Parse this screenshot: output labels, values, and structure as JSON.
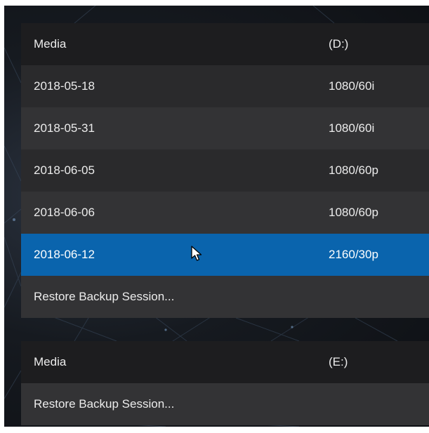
{
  "drive_d": {
    "header": {
      "label": "Media",
      "drive": "(D:)"
    },
    "sessions": [
      {
        "date": "2018-05-18",
        "format": "1080/60i"
      },
      {
        "date": "2018-05-31",
        "format": "1080/60i"
      },
      {
        "date": "2018-06-05",
        "format": "1080/60p"
      },
      {
        "date": "2018-06-06",
        "format": "1080/60p"
      },
      {
        "date": "2018-06-12",
        "format": "2160/30p"
      }
    ],
    "restore_label": "Restore Backup Session..."
  },
  "drive_e": {
    "header": {
      "label": "Media",
      "drive": "(E:)"
    },
    "restore_label": "Restore Backup Session..."
  },
  "colors": {
    "header_bg": "#1d1d1f",
    "row_bg_a": "#2a2a2c",
    "row_bg_b": "#333335",
    "selected_bg": "#0a64ad",
    "text": "#ececec"
  },
  "icons": {
    "pointer": "mouse-pointer-icon"
  }
}
